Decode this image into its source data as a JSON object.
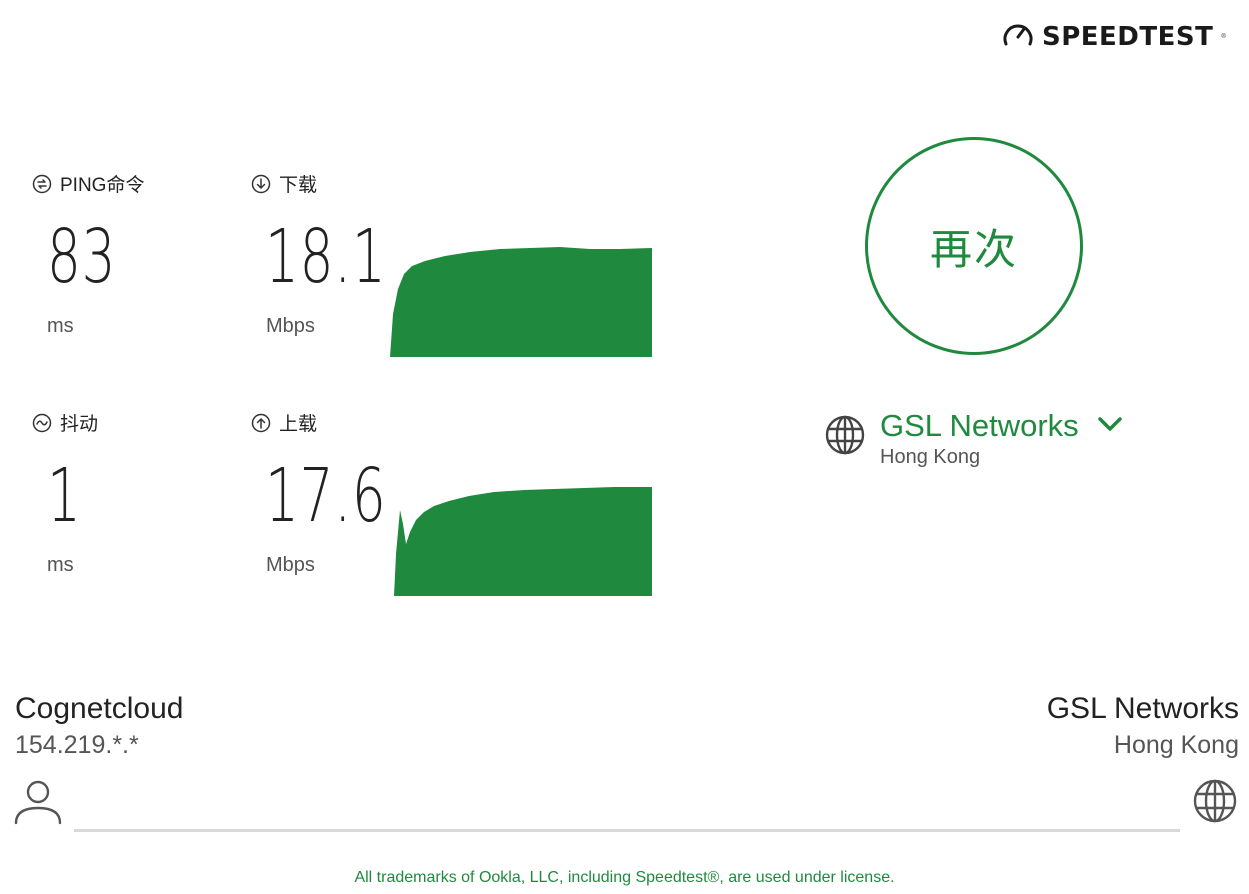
{
  "brand": {
    "name": "SPEEDTEST",
    "tm": "®",
    "icon": "speedometer-icon"
  },
  "metrics": {
    "ping": {
      "label": "PING命令",
      "value": "83",
      "unit": "ms",
      "icon": "ping-icon"
    },
    "download": {
      "label": "下载",
      "value": "18.1",
      "unit": "Mbps",
      "icon": "download-arrow-icon"
    },
    "jitter": {
      "label": "抖动",
      "value": "1",
      "unit": "ms",
      "icon": "jitter-wave-icon"
    },
    "upload": {
      "label": "上载",
      "value": "17.6",
      "unit": "Mbps",
      "icon": "upload-arrow-icon"
    }
  },
  "go_button": {
    "label": "再次"
  },
  "server": {
    "name": "GSL Networks",
    "location": "Hong Kong",
    "icon": "globe-icon",
    "chevron": "chevron-down-icon"
  },
  "connection": {
    "isp": "Cognetcloud",
    "ip": "154.219.*.*",
    "host": "GSL Networks",
    "host_location": "Hong Kong",
    "user_icon": "user-icon",
    "host_icon": "globe-icon"
  },
  "footer": {
    "text": "All trademarks of Ookla, LLC, including Speedtest®, are used under license."
  },
  "colors": {
    "accent": "#1f8a3e",
    "graph_fill": "#1f8a3e",
    "line": "#d9d9d9"
  }
}
